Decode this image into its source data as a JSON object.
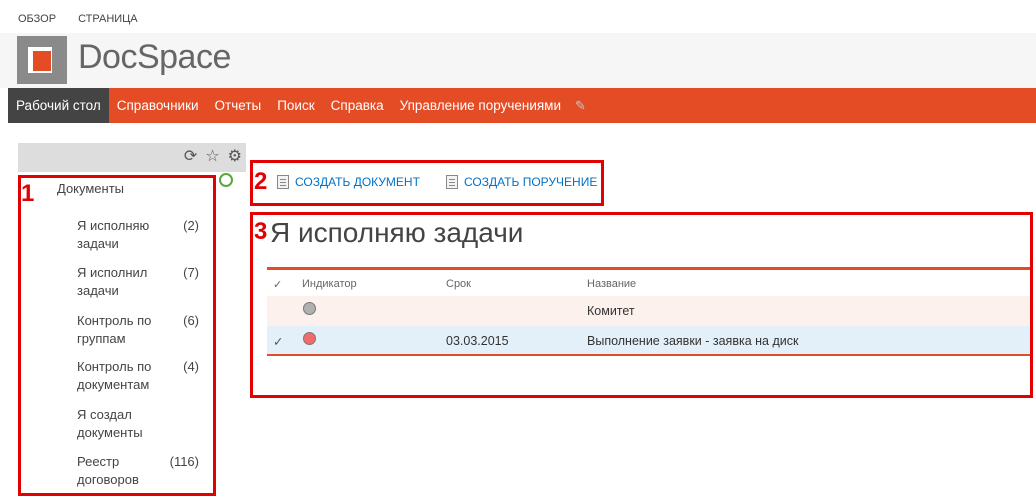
{
  "top_links": [
    "ОБЗОР",
    "СТРАНИЦА"
  ],
  "brand": {
    "name": "DocSpace",
    "accent": "#e44c26"
  },
  "nav": {
    "items": [
      "Рабочий стол",
      "Справочники",
      "Отчеты",
      "Поиск",
      "Справка",
      "Управление поручениями"
    ],
    "active_index": 0
  },
  "panel_icons": [
    "sync-icon",
    "star-icon",
    "gear-icon"
  ],
  "callouts": [
    "1",
    "2",
    "3"
  ],
  "tree": {
    "root": "Документы",
    "items": [
      {
        "label": "Я исполняю задачи",
        "count": "(2)"
      },
      {
        "label": "Я исполнил задачи",
        "count": "(7)"
      },
      {
        "label": "Контроль по группам",
        "count": "(6)"
      },
      {
        "label": "Контроль по документам",
        "count": "(4)"
      },
      {
        "label": "Я создал документы",
        "count": ""
      },
      {
        "label": "Реестр договоров",
        "count": "(116)"
      }
    ]
  },
  "actions": {
    "create_document": "СОЗДАТЬ ДОКУМЕНТ",
    "create_task": "СОЗДАТЬ ПОРУЧЕНИЕ"
  },
  "section": {
    "title": "Я исполняю задачи"
  },
  "table": {
    "headers": {
      "check": "✓",
      "indicator": "Индикатор",
      "deadline": "Срок",
      "name": "Название"
    },
    "rows": [
      {
        "checked": "",
        "indicator": "#b0b0b0",
        "deadline": "",
        "name": "Комитет"
      },
      {
        "checked": "✓",
        "indicator": "#f26b6b",
        "deadline": "03.03.2015",
        "name": "Выполнение заявки - заявка на диск"
      }
    ]
  }
}
